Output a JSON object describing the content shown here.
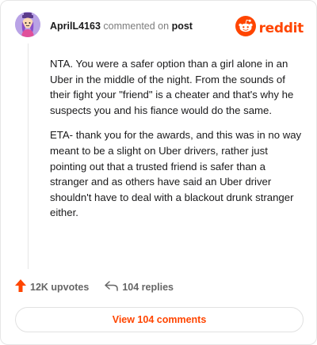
{
  "header": {
    "username": "AprilL4163",
    "action": "commented on",
    "target": "post"
  },
  "brand": {
    "name": "reddit",
    "icon": "reddit-snoo-icon",
    "color": "#ff4500"
  },
  "comment": {
    "paragraphs": [
      "NTA. You were a safer option than a girl alone in an Uber in the middle of the night. From the sounds of their fight your \"friend\" is a cheater and that's why he suspects you and his fiance would do the same.",
      "ETA- thank you for the awards, and this was in no way meant to be a slight on Uber drivers, rather just pointing out that a trusted friend is safer than a stranger and as others have said an Uber driver shouldn't have to deal with a blackout drunk stranger either."
    ]
  },
  "footer": {
    "upvotes": "12K upvotes",
    "upvote_icon": "upvote-arrow-icon",
    "replies": "104 replies",
    "reply_icon": "reply-arrow-icon"
  },
  "view_button": {
    "label": "View 104 comments"
  }
}
